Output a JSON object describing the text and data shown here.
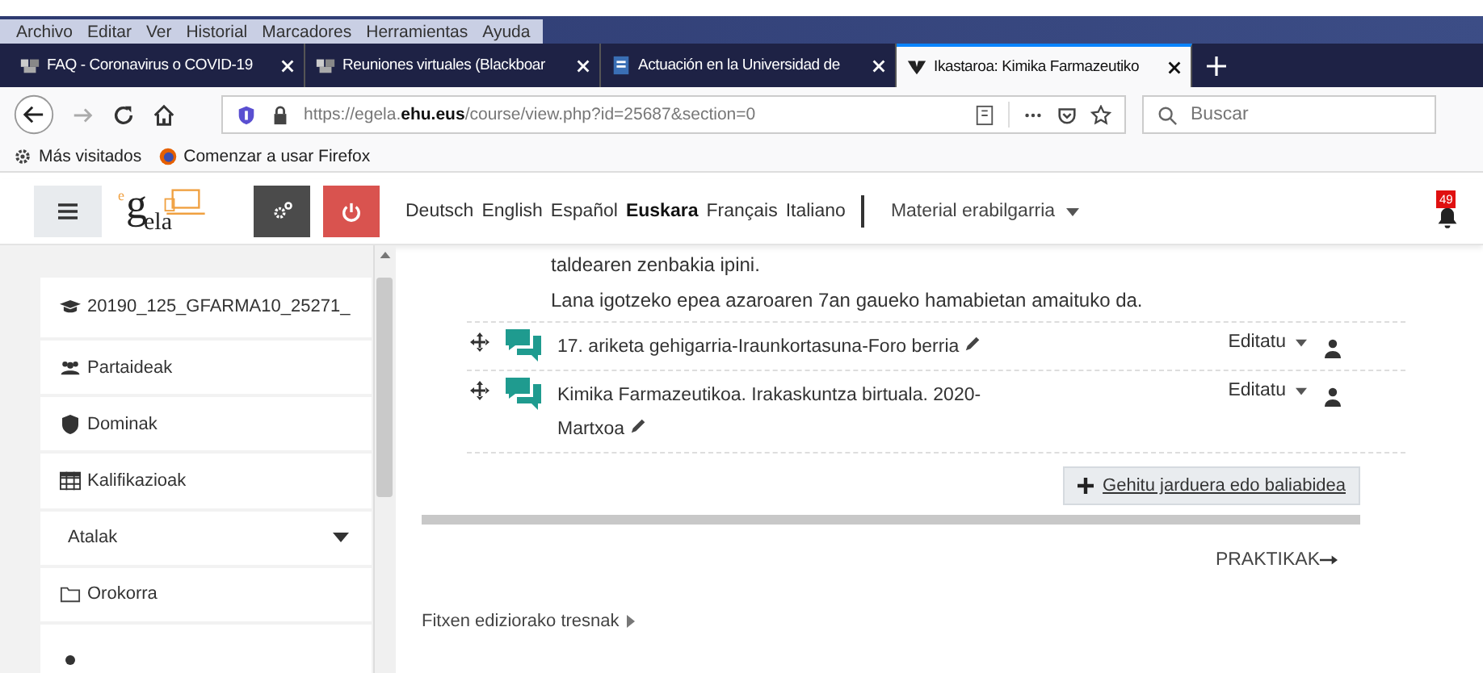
{
  "menu_bar": [
    "Archivo",
    "Editar",
    "Ver",
    "Historial",
    "Marcadores",
    "Herramientas",
    "Ayuda"
  ],
  "tabs": [
    {
      "title": "FAQ - Coronavirus o COVID-19",
      "kind": "bb",
      "selected": false
    },
    {
      "title": "Reuniones virtuales (Blackboar",
      "kind": "bb",
      "selected": false
    },
    {
      "title": "Actuación en la Universidad de",
      "kind": "doc",
      "selected": false
    },
    {
      "title": "Ikastaroa: Kimika Farmazeutiko",
      "kind": "ehu",
      "selected": true
    }
  ],
  "url": {
    "prefix": "https://egela.",
    "domain": "ehu.eus",
    "path": "/course/view.php?id=25687&section=0"
  },
  "search": {
    "placeholder": "Buscar"
  },
  "bookmarks": [
    {
      "label": "Más visitados",
      "kind": "gear"
    },
    {
      "label": "Comenzar a usar Firefox",
      "kind": "firefox"
    }
  ],
  "site_header": {
    "logo_sup": "e",
    "logo_main": "g",
    "logo_sub": "ela",
    "languages": [
      {
        "label": "Deutsch",
        "selected": false
      },
      {
        "label": "English",
        "selected": false
      },
      {
        "label": "Español",
        "selected": false
      },
      {
        "label": "Euskara",
        "selected": true
      },
      {
        "label": "Français",
        "selected": false
      },
      {
        "label": "Italiano",
        "selected": false
      }
    ],
    "menu": "Material erabilgarria",
    "notifications": "49"
  },
  "sidebar": {
    "items": [
      {
        "label": "20190_125_GFARMA10_25271_",
        "kind": "course"
      },
      {
        "label": "Partaideak",
        "kind": "users"
      },
      {
        "label": "Dominak",
        "kind": "shield"
      },
      {
        "label": "Kalifikazioak",
        "kind": "table"
      },
      {
        "label": "Atalak",
        "kind": "section"
      },
      {
        "label": "Orokorra",
        "kind": "folder"
      }
    ]
  },
  "content": {
    "paragraphs": [
      "taldearen zenbakia ipini.",
      "Lana igotzeko epea azaroaren 7an gaueko hamabietan amaituko da."
    ],
    "activities": [
      {
        "title": "17. ariketa gehigarria-Iraunkortasuna-Foro berria",
        "edit": "Editatu"
      },
      {
        "title": "Kimika Farmazeutikoa. Irakaskuntza birtuala. 2020-Martxoa",
        "edit": "Editatu"
      }
    ],
    "add_button": "Gehitu jarduera edo baliabidea",
    "next_section": "PRAKTIKAK",
    "footer_link": "Fitxen ediziorako tresnak"
  }
}
